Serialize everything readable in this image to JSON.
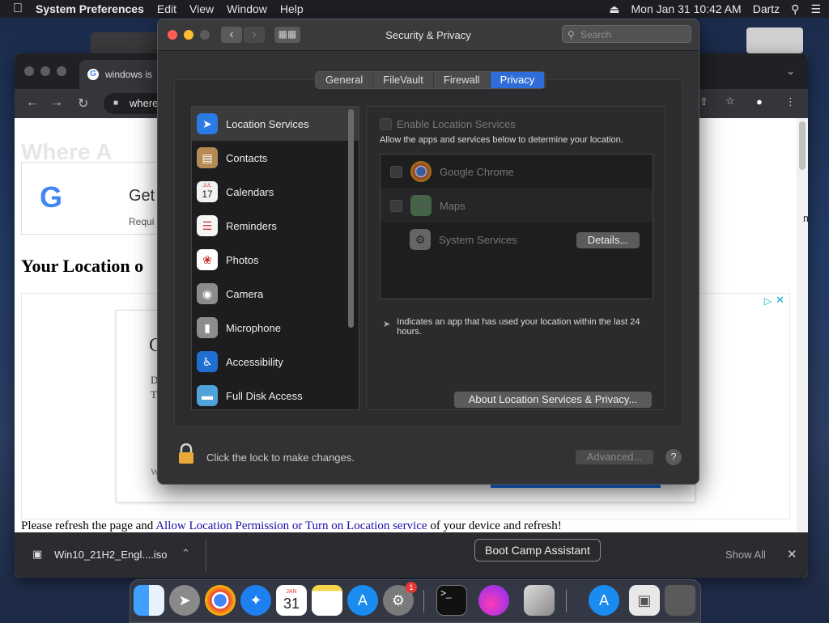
{
  "menubar": {
    "app_name": "System Preferences",
    "items": [
      "Edit",
      "View",
      "Window",
      "Help"
    ],
    "datetime": "Mon Jan 31  10:42 AM",
    "user": "Dartz"
  },
  "chrome": {
    "tab_title": "windows is",
    "url_fragment": "where",
    "faded_heading": "Where A",
    "card_title": "Get",
    "card_sub": "Requi",
    "heading": "Your Location o",
    "inner_letters": [
      "D",
      "T",
      "C",
      "W"
    ],
    "refresh_before": "Please refresh the page and ",
    "refresh_link": "Allow Location Permission or Turn on Location service",
    "refresh_after": " of your device and refresh!",
    "right_text": "m",
    "download_file": "Win10_21H2_Engl....iso",
    "show_all": "Show All"
  },
  "prefs": {
    "title": "Security & Privacy",
    "search_placeholder": "Search",
    "tabs": [
      "General",
      "FileVault",
      "Firewall",
      "Privacy"
    ],
    "selected_tab": "Privacy",
    "categories": [
      {
        "label": "Location Services",
        "icon": "location-arrow-icon",
        "color": "#2a7be4"
      },
      {
        "label": "Contacts",
        "icon": "contacts-book-icon",
        "color": "#b58a55"
      },
      {
        "label": "Calendars",
        "icon": "calendar-icon",
        "color": "#f2f2f2"
      },
      {
        "label": "Reminders",
        "icon": "reminders-list-icon",
        "color": "#f5f5f5"
      },
      {
        "label": "Photos",
        "icon": "photos-flower-icon",
        "color": "#ffffff"
      },
      {
        "label": "Camera",
        "icon": "camera-icon",
        "color": "#8c8c8c"
      },
      {
        "label": "Microphone",
        "icon": "microphone-icon",
        "color": "#8c8c8c"
      },
      {
        "label": "Accessibility",
        "icon": "accessibility-person-icon",
        "color": "#1f6fd1"
      },
      {
        "label": "Full Disk Access",
        "icon": "folder-icon",
        "color": "#4fa3d9"
      }
    ],
    "calendar_month": "JUL",
    "calendar_day": "17",
    "enable_label": "Enable Location Services",
    "allow_text": "Allow the apps and services below to determine your location.",
    "apps": [
      {
        "name": "Google Chrome",
        "icon": "chrome-icon"
      },
      {
        "name": "Maps",
        "icon": "maps-icon"
      },
      {
        "name": "System Services",
        "icon": "gear-icon"
      }
    ],
    "details_button": "Details...",
    "indicator_note": "Indicates an app that has used your location within the last 24 hours.",
    "about_button": "About Location Services & Privacy...",
    "lock_text": "Click the lock to make changes.",
    "advanced_button": "Advanced...",
    "help_symbol": "?"
  },
  "dock": {
    "tooltip": "Boot Camp Assistant",
    "calendar_month": "JAN",
    "calendar_day": "31",
    "badge": "1"
  }
}
